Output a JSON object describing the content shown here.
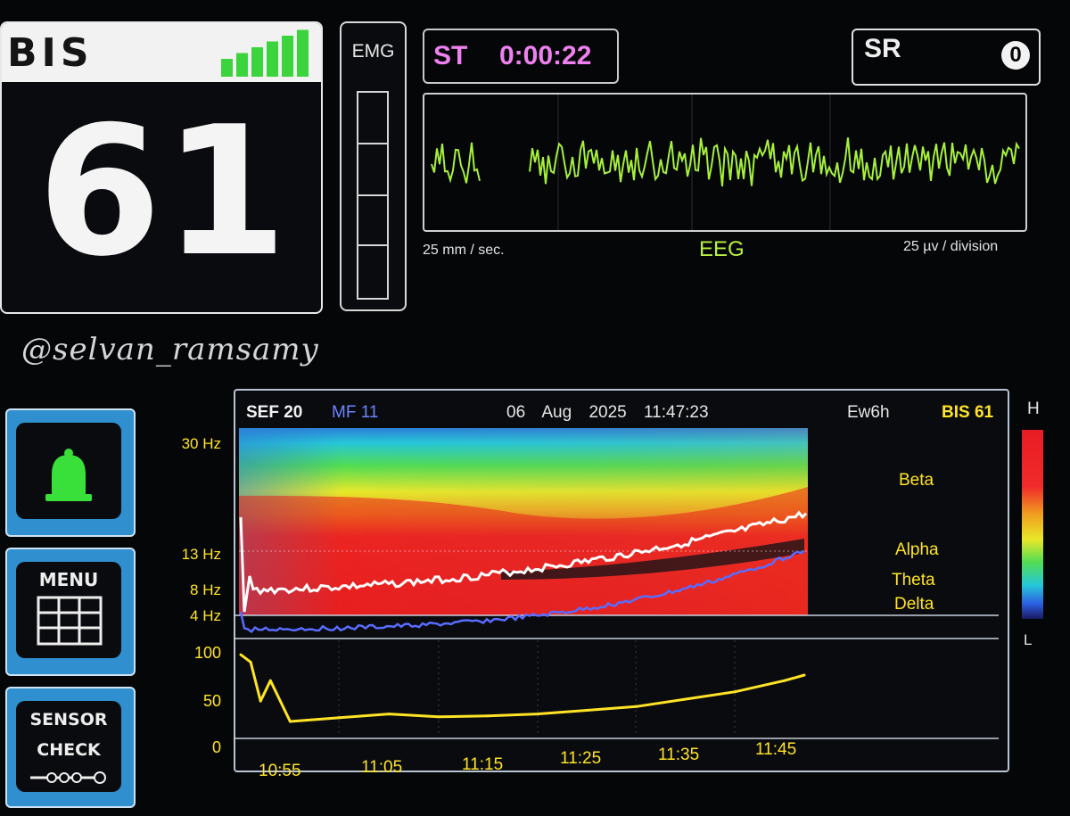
{
  "bis": {
    "title": "BIS",
    "value": "61",
    "signal_quality_bars": 6,
    "bar_color": "#3cd43c"
  },
  "emg": {
    "label": "EMG",
    "level": 0
  },
  "st": {
    "label": "ST",
    "value": "0:00:22",
    "color": "#ef80ef"
  },
  "sr": {
    "label": "SR",
    "value": "0"
  },
  "eeg": {
    "label": "EEG",
    "speed": "25 mm / sec.",
    "scale": "25 µv / division",
    "trace_color": "#a6f03c"
  },
  "watermark": "@selvan_ramsamy",
  "buttons": {
    "alarm": {
      "icon": "bell-icon",
      "color": "#3ae03a"
    },
    "menu": {
      "label": "MENU",
      "icon": "grid-icon"
    },
    "sensor": {
      "line1": "SENSOR",
      "line2": "CHECK",
      "icon": "sensor-icon"
    }
  },
  "dsa": {
    "sef": "SEF 20",
    "mf": "MF 11",
    "date": "06 Aug 2025",
    "time": "11:47:23",
    "window": "Ew6h",
    "bis": "BIS 61",
    "freq_labels": [
      "30 Hz",
      "13 Hz",
      "8 Hz",
      "4 Hz"
    ],
    "bands": [
      "Beta",
      "Alpha",
      "Theta",
      "Delta"
    ],
    "scale_high": "H",
    "scale_low": "L"
  },
  "trend": {
    "y_labels": [
      "100",
      "50",
      "0"
    ],
    "x_labels": [
      "10:55",
      "11:05",
      "11:15",
      "11:25",
      "11:35",
      "11:45"
    ]
  },
  "chart_data": {
    "type": "line",
    "title": "",
    "xlabel": "",
    "ylabel": "",
    "x": [
      "10:50",
      "10:51",
      "10:52",
      "10:53",
      "10:55",
      "11:00",
      "11:05",
      "11:10",
      "11:15",
      "11:20",
      "11:25",
      "11:30",
      "11:35",
      "11:40",
      "11:45",
      "11:47"
    ],
    "series": [
      {
        "values": [
          98,
          90,
          48,
          70,
          26,
          30,
          34,
          31,
          32,
          34,
          38,
          42,
          50,
          58,
          70,
          76
        ]
      }
    ],
    "ylim": [
      0,
      100
    ],
    "yticks": [
      0,
      50,
      100
    ],
    "line_color": "#ffe426"
  }
}
